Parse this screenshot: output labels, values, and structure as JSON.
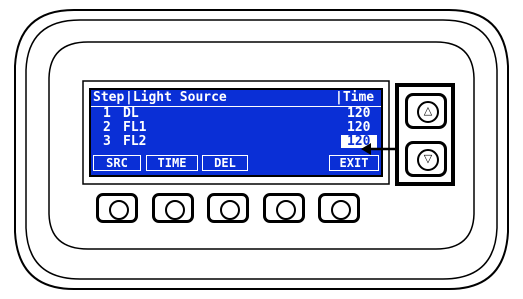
{
  "screen": {
    "header": {
      "step": "Step",
      "source": "|Light Source",
      "time": "|Time"
    },
    "rows": [
      {
        "step": "1",
        "source": "DL",
        "time": "120",
        "selected": false
      },
      {
        "step": "2",
        "source": "FL1",
        "time": "120",
        "selected": false
      },
      {
        "step": "3",
        "source": "FL2",
        "time": "120",
        "selected": true
      }
    ],
    "softkeys": [
      "SRC",
      "TIME",
      "DEL",
      "EXIT"
    ]
  },
  "nav": {
    "up_icon": "up-triangle-icon",
    "down_icon": "down-triangle-icon",
    "up_glyph": "△",
    "down_glyph": "▽"
  },
  "colors": {
    "screen_bg": "#0a2fd6",
    "text": "#ffffff"
  }
}
